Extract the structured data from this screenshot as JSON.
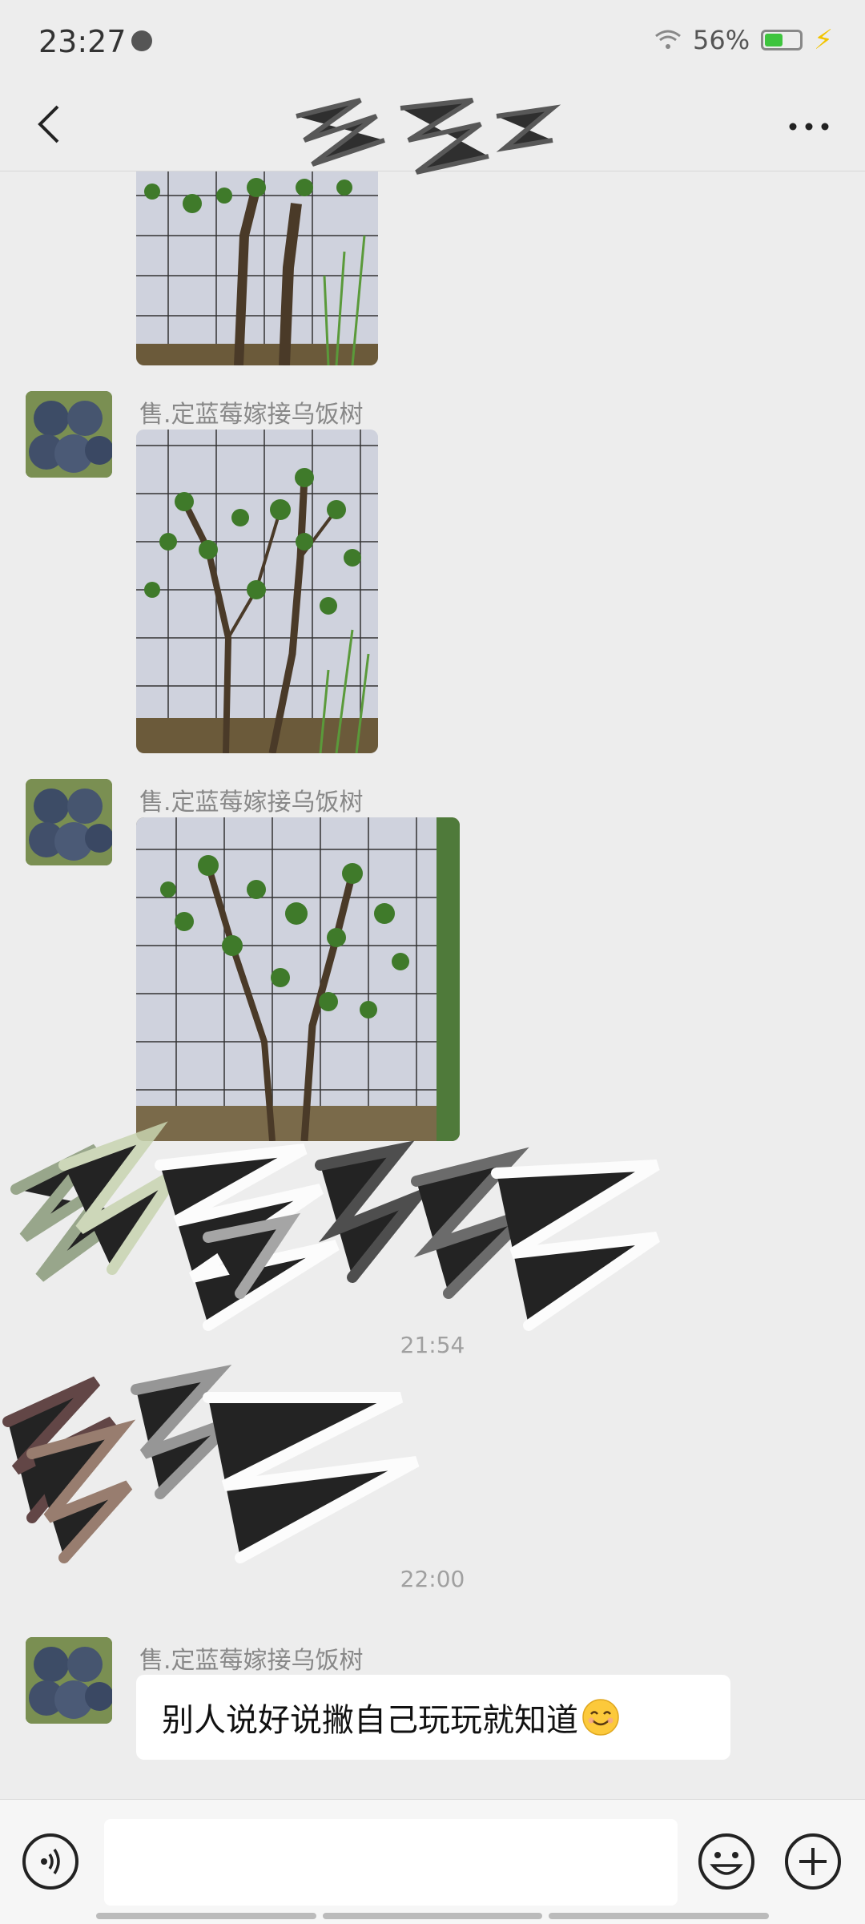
{
  "status": {
    "time": "23:27",
    "battery": "56%",
    "battery_level": 0.56
  },
  "header": {
    "back_icon": "back-arrow-icon",
    "more_icon": "more-dots-icon"
  },
  "messages": [
    {
      "sender": "售.定蓝莓嫁接乌饭树"
    },
    {
      "sender": "售.定蓝莓嫁接乌饭树"
    },
    {
      "sender": "售.定蓝莓嫁接乌饭树",
      "text": "别人说好说撇自己玩玩就知道"
    }
  ],
  "time_labels": [
    "21:54",
    "22:00"
  ],
  "input": {
    "voice_icon": "voice-icon",
    "emoji_icon": "emoji-icon",
    "plus_icon": "plus-icon"
  }
}
